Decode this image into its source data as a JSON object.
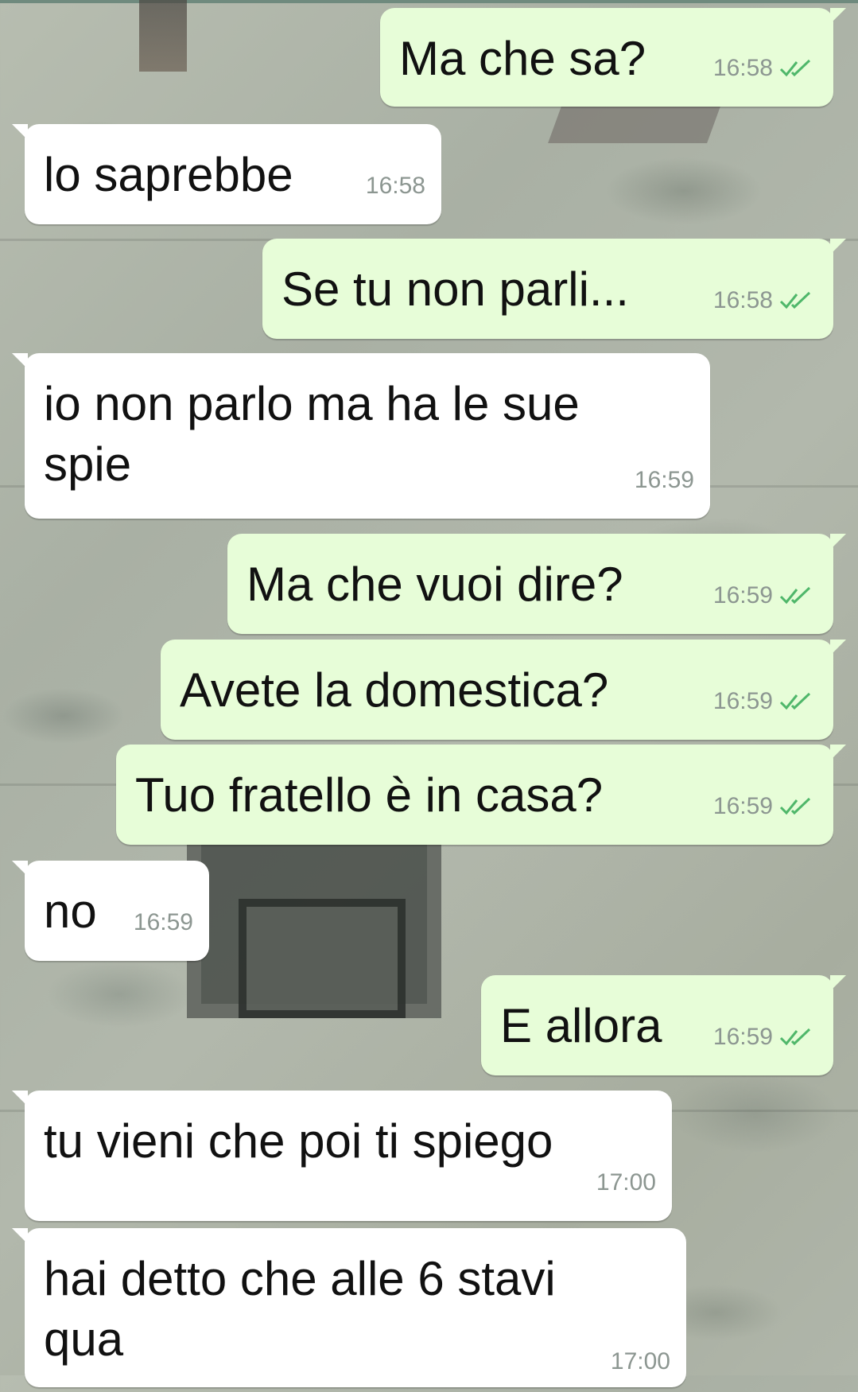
{
  "messages": [
    {
      "dir": "out",
      "text": "Ma che sa?",
      "time": "16:58",
      "read": true
    },
    {
      "dir": "in",
      "text": "lo saprebbe",
      "time": "16:58"
    },
    {
      "dir": "out",
      "text": "Se tu non parli...",
      "time": "16:58",
      "read": true
    },
    {
      "dir": "in",
      "text": "io non parlo ma ha le sue spie",
      "time": "16:59"
    },
    {
      "dir": "out",
      "text": "Ma che vuoi dire?",
      "time": "16:59",
      "read": true
    },
    {
      "dir": "out",
      "text": "Avete la domestica?",
      "time": "16:59",
      "read": true
    },
    {
      "dir": "out",
      "text": "Tuo fratello è in casa?",
      "time": "16:59",
      "read": true
    },
    {
      "dir": "in",
      "text": "no",
      "time": "16:59"
    },
    {
      "dir": "out",
      "text": "E allora",
      "time": "16:59",
      "read": true
    },
    {
      "dir": "in",
      "text": "tu vieni che poi ti spiego",
      "time": "17:00"
    },
    {
      "dir": "in",
      "text": "hai detto che alle 6 stavi qua",
      "time": "17:00"
    }
  ],
  "colors": {
    "outgoing_bubble": "#e7fdd8",
    "incoming_bubble": "#ffffff",
    "read_ticks": "#4fb76a",
    "timestamp": "#8c9691"
  },
  "icons": {
    "read_receipt": "double-check-icon"
  }
}
